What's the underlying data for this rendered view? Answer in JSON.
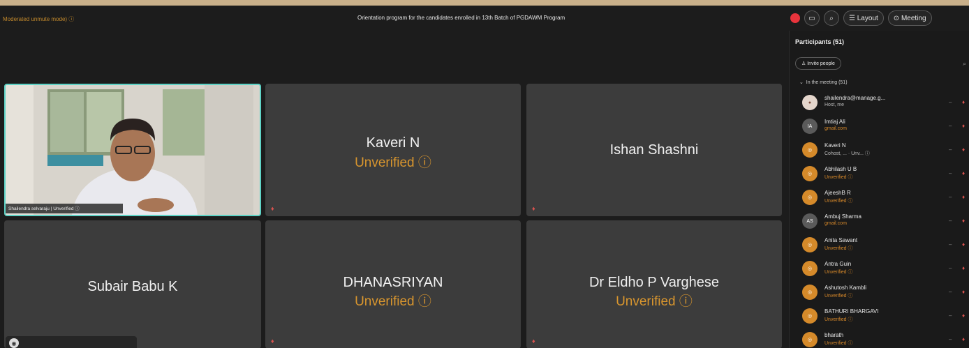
{
  "topbar": {
    "moderation_status": "Moderated unmute mode) ⓘ",
    "meeting_title": "Orientation program for the candidates enrolled in 13th Batch of PGDAWM Program",
    "layout_label": "Layout",
    "meeting_label": "Meeting"
  },
  "tiles": {
    "video_label": "Shailendra selvaraju | Unverified ⓘ",
    "kaveri_name": "Kaveri N",
    "ishan_name": "Ishan Shashni",
    "subair_name": "Subair Babu K",
    "dhanasriyan_name": "DHANASRIYAN",
    "eldho_name": "Dr Eldho P Varghese",
    "unverified": "Unverified ⓘ"
  },
  "panel": {
    "title": "Participants (51)",
    "invite_label": "Invite people",
    "section_label": "In the meeting (51)",
    "participants": [
      {
        "name": "shailendra@manage.g...",
        "sub": "Host, me",
        "initials": ""
      },
      {
        "name": "Imtiaj Ali",
        "sub": "gmail.com",
        "initials": "IA"
      },
      {
        "name": "Kaveri N",
        "sub": "Cohost, ... · Unv... ⓘ",
        "initials": ""
      },
      {
        "name": "Abhilash U B",
        "sub": "Unverified ⓘ",
        "initials": ""
      },
      {
        "name": "AjeeshB R",
        "sub": "Unverified ⓘ",
        "initials": ""
      },
      {
        "name": "Ambuj Sharma",
        "sub": "gmail.com",
        "initials": "AS"
      },
      {
        "name": "Anita Sawant",
        "sub": "Unverified ⓘ",
        "initials": ""
      },
      {
        "name": "Antra Guin",
        "sub": "Unverified ⓘ",
        "initials": ""
      },
      {
        "name": "Ashutosh Kambli",
        "sub": "Unverified ⓘ",
        "initials": ""
      },
      {
        "name": "BATHURI BHARGAVI",
        "sub": "Unverified ⓘ",
        "initials": ""
      },
      {
        "name": "bharath",
        "sub": "Unverified ⓘ",
        "initials": ""
      }
    ]
  },
  "colors": {
    "unverified": "#d9962e",
    "active_speaker_border": "#5fd3c6",
    "record": "#e8343c"
  }
}
